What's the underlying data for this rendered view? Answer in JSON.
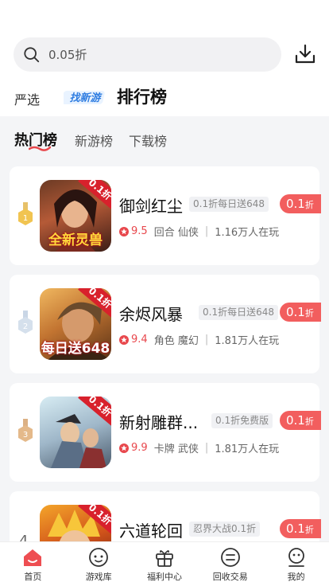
{
  "search": {
    "placeholder": "0.05折",
    "icon": "search-icon"
  },
  "download_icon": "download-icon",
  "top_nav": {
    "item1": "严选",
    "logo_text": "找新游",
    "item3": "排行榜"
  },
  "sub_tabs": [
    "热门榜",
    "新游榜",
    "下载榜"
  ],
  "games": [
    {
      "rank": "1",
      "name": "御剑红尘",
      "tag": "0.1折每日送648",
      "score": "9.5",
      "genre": "回合 仙侠",
      "players": "1.16万人在玩",
      "discount": "0.1",
      "discount_unit": "折",
      "corner": "0.1折",
      "cover_caption": "全新灵兽",
      "medal": "gold"
    },
    {
      "rank": "2",
      "name": "余烬风暴",
      "tag": "0.1折每日送648",
      "score": "9.4",
      "genre": "角色 魔幻",
      "players": "1.81万人在玩",
      "discount": "0.1",
      "discount_unit": "折",
      "corner": "0.1折",
      "cover_caption": "每日送648",
      "medal": "silver"
    },
    {
      "rank": "3",
      "name": "新射雕群...",
      "tag": "0.1折免费版",
      "score": "9.9",
      "genre": "卡牌 武侠",
      "players": "1.81万人在玩",
      "discount": "0.1",
      "discount_unit": "折",
      "corner": "0.1折",
      "cover_caption": "",
      "medal": "bronze"
    },
    {
      "rank": "4",
      "name": "六道轮回",
      "tag": "忍界大战0.1折",
      "score": "",
      "genre": "",
      "players": "",
      "discount": "0.1",
      "discount_unit": "折",
      "corner": "0.1折",
      "cover_caption": "",
      "medal": "none"
    }
  ],
  "tabbar": [
    {
      "label": "首页",
      "icon": "home-icon",
      "active": true
    },
    {
      "label": "游戏库",
      "icon": "game-library-icon",
      "active": false
    },
    {
      "label": "福利中心",
      "icon": "gift-icon",
      "active": false
    },
    {
      "label": "回收交易",
      "icon": "recycle-icon",
      "active": false
    },
    {
      "label": "我的",
      "icon": "profile-icon",
      "active": false
    }
  ],
  "colors": {
    "accent": "#e8474c",
    "discount_bg": "#f25e5e",
    "background": "#f4f5f7"
  }
}
